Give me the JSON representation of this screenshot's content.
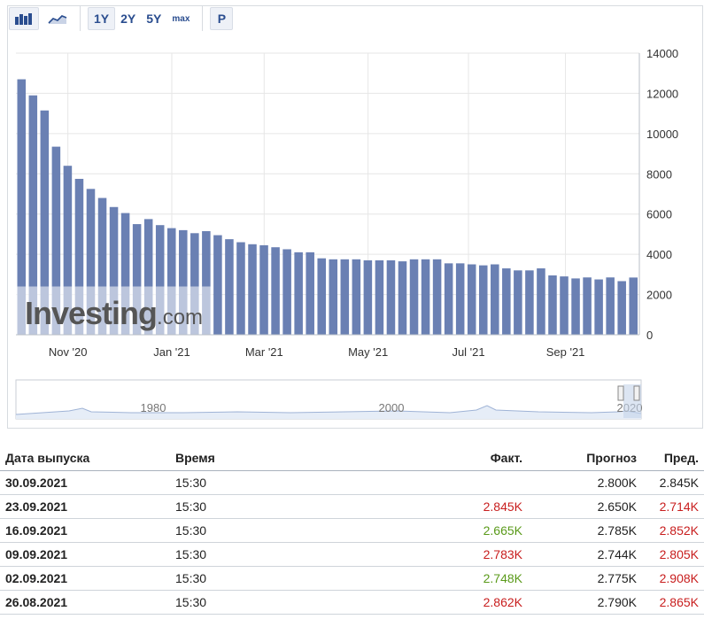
{
  "toolbar": {
    "chart_types": [
      "bar-chart-icon",
      "area-chart-icon"
    ],
    "ranges": [
      "1Y",
      "2Y",
      "5Y",
      "max"
    ],
    "active_range": "1Y",
    "p_label": "P"
  },
  "colors": {
    "bar": "#6a80b3",
    "grid": "#e6e6e6",
    "axis": "#333333",
    "negative": "#c81e1e",
    "positive": "#5a9a1a",
    "watermark": "#555555"
  },
  "watermark": {
    "brand": "Investing",
    "suffix": ".com"
  },
  "chart_data": {
    "type": "bar",
    "ylim": [
      0,
      14000
    ],
    "yticks": [
      0,
      2000,
      4000,
      6000,
      8000,
      10000,
      12000,
      14000
    ],
    "ytick_labels": [
      "0",
      "2000",
      "4000",
      "6000",
      "8000",
      "10000",
      "12000",
      "14000"
    ],
    "xtick_labels": [
      "Nov '20",
      "Jan '21",
      "Mar '21",
      "May '21",
      "Jul '21",
      "Sep '21"
    ],
    "xtick_after_bar": [
      4.5,
      13.5,
      21.5,
      30.5,
      39.2,
      47.6
    ],
    "values": [
      12700,
      11900,
      11150,
      9350,
      8400,
      7750,
      7250,
      6800,
      6350,
      6050,
      5500,
      5750,
      5450,
      5300,
      5200,
      5050,
      5150,
      4950,
      4750,
      4600,
      4500,
      4450,
      4350,
      4250,
      4100,
      4100,
      3800,
      3750,
      3750,
      3750,
      3700,
      3700,
      3700,
      3650,
      3750,
      3750,
      3750,
      3550,
      3550,
      3500,
      3450,
      3500,
      3300,
      3200,
      3200,
      3300,
      2950,
      2900,
      2800,
      2850,
      2750,
      2850,
      2665,
      2845
    ]
  },
  "navigator": {
    "labels": [
      "1980",
      "2000",
      "2020"
    ]
  },
  "table": {
    "headers": [
      "Дата выпуска",
      "Время",
      "Факт.",
      "Прогноз",
      "Пред."
    ],
    "rows": [
      {
        "date": "30.09.2021",
        "time": "15:30",
        "actual": "",
        "actual_class": "neu",
        "forecast": "2.800K",
        "previous": "2.845K",
        "previous_class": "neu"
      },
      {
        "date": "23.09.2021",
        "time": "15:30",
        "actual": "2.845K",
        "actual_class": "neg",
        "forecast": "2.650K",
        "previous": "2.714K",
        "previous_class": "neg"
      },
      {
        "date": "16.09.2021",
        "time": "15:30",
        "actual": "2.665K",
        "actual_class": "pos",
        "forecast": "2.785K",
        "previous": "2.852K",
        "previous_class": "neg"
      },
      {
        "date": "09.09.2021",
        "time": "15:30",
        "actual": "2.783K",
        "actual_class": "neg",
        "forecast": "2.744K",
        "previous": "2.805K",
        "previous_class": "neg"
      },
      {
        "date": "02.09.2021",
        "time": "15:30",
        "actual": "2.748K",
        "actual_class": "pos",
        "forecast": "2.775K",
        "previous": "2.908K",
        "previous_class": "neg"
      },
      {
        "date": "26.08.2021",
        "time": "15:30",
        "actual": "2.862K",
        "actual_class": "neg",
        "forecast": "2.790K",
        "previous": "2.865K",
        "previous_class": "neg"
      }
    ]
  }
}
